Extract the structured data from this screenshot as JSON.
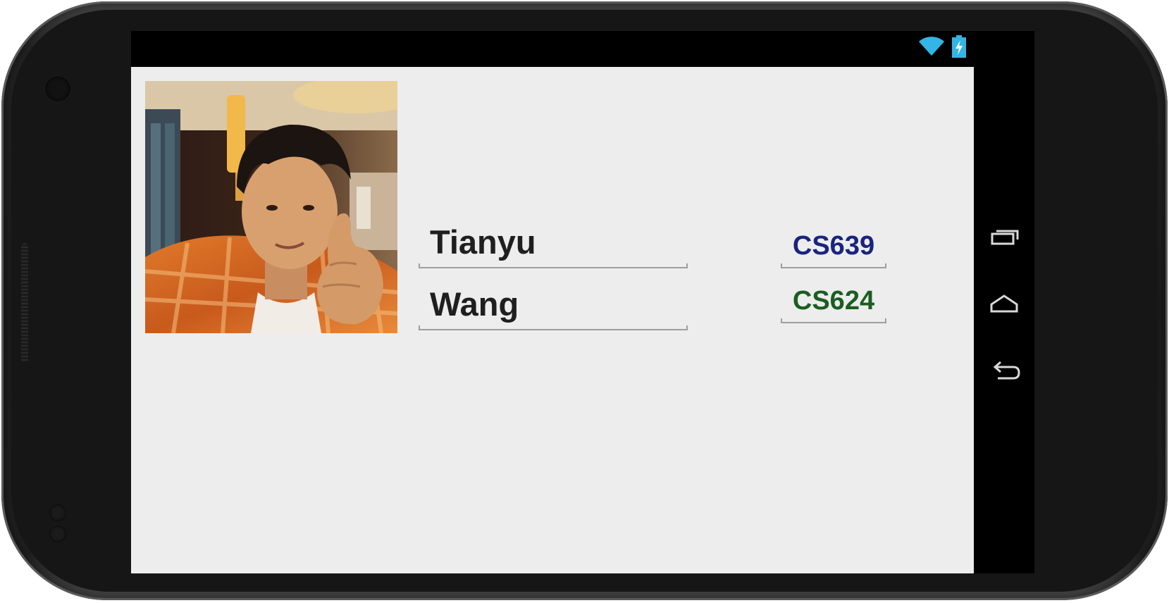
{
  "device": {
    "frame_color": "#1c1c1c",
    "screen_bg": "#ededed"
  },
  "statusbar": {
    "icons": [
      "wifi-icon",
      "battery-charging-icon"
    ],
    "accent_color": "#33b5e5"
  },
  "profile": {
    "first_name": "Tianyu",
    "last_name": "Wang",
    "photo_icon": "profile-photo"
  },
  "courses": [
    {
      "code": "CS639",
      "color": "#1a237e"
    },
    {
      "code": "CS624",
      "color": "#1b5e20"
    }
  ],
  "navbar": {
    "buttons": [
      "recent-apps-icon",
      "home-icon",
      "back-icon"
    ]
  }
}
